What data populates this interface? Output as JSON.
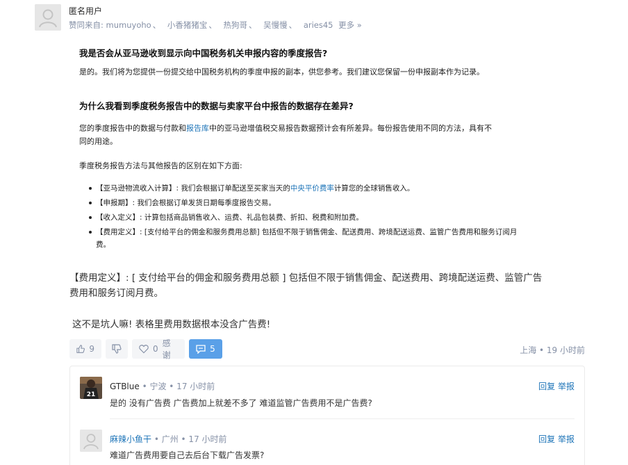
{
  "answer": {
    "author": "匿名用户",
    "agree_prefix": "赞同来自:",
    "agreed_users": [
      "mumuyoho",
      "小香猪猪宝",
      "热狗哥",
      "吴慢慢",
      "aries45"
    ],
    "agree_separator": "、",
    "more_label": "更多 »"
  },
  "faq": {
    "q1": "我是否会从亚马逊收到显示向中国税务机关申报内容的季度报告?",
    "a1": "是的。我们将为您提供一份提交给中国税务机构的季度申报的副本，供您参考。我们建议您保留一份申报副本作为记录。",
    "q2": "为什么我看到季度税务报告中的数据与卖家平台中报告的数据存在差异?",
    "a2_part1": "您的季度报告中的数据与付款和",
    "a2_link": "报告库",
    "a2_part2": "中的亚马逊增值税交易报告数据预计会有所差异。每份报告使用不同的方法，具有不",
    "a2_line2": "同的用途。",
    "a3": "季度税务报告方法与其他报告的区别在如下方面:",
    "bullets": [
      {
        "pre": "【亚马逊物流收入计算】:  我们会根据订单配送至买家当天的",
        "link": "中央平价费率",
        "post": "计算您的全球销售收入。"
      },
      {
        "pre": "【申报期】:  我们会根据订单发货日期每季度报告交易。",
        "link": "",
        "post": ""
      },
      {
        "pre": "【收入定义】:  计算包括商品销售收入、运费、礼品包装费、折扣、税费和附加费。",
        "link": "",
        "post": ""
      },
      {
        "pre": "【费用定义】:  [支付给平台的佣金和服务费用总额] 包括但不限于销售佣金、配送费用、跨境配送运费、监管广告费用和服务订阅月费。",
        "link": "",
        "post": ""
      }
    ]
  },
  "comment": {
    "line1": "【费用定义】:  [ 支付给平台的佣金和服务费用总额 ]  包括但不限于销售佣金、配送费用、跨境配送运费、监管广告",
    "line2": "费用和服务订阅月费。",
    "line3": "这不是坑人嘛! 表格里费用数据根本没含广告费!"
  },
  "actions": {
    "likes": "9",
    "thanks_count": "0",
    "thanks_label": "感谢",
    "comments": "5",
    "location_time": "上海 • 19 小时前"
  },
  "replies": [
    {
      "user": "GTBlue",
      "meta": " • 宁波 • 17 小时前",
      "text": "是的 没有广告费 广告费加上就差不多了 难道监管广告费用不是广告费?",
      "reply_label": "回复",
      "report_label": "举报",
      "avatar_number": "21"
    },
    {
      "user": "麻辣小鱼干",
      "meta": " • 广州 • 17 小时前",
      "text": "难道广告费用要自己去后台下载广告发票?",
      "reply_label": "回复",
      "report_label": "举报"
    }
  ]
}
